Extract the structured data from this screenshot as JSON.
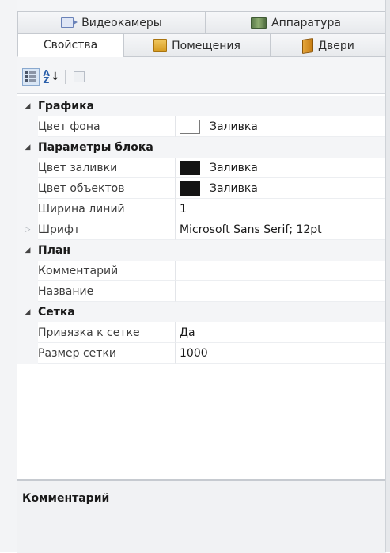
{
  "tabs_row1": [
    {
      "label": "Видеокамеры",
      "icon": "camera-icon"
    },
    {
      "label": "Аппаратура",
      "icon": "hardware-icon"
    }
  ],
  "tabs_row2": [
    {
      "label": "Свойства",
      "icon": null,
      "active": true
    },
    {
      "label": "Помещения",
      "icon": "rooms-icon"
    },
    {
      "label": "Двери",
      "icon": "door-icon"
    }
  ],
  "toolbar": {
    "categorized": "categorized-view-icon",
    "alphabetical": "sort-alphabetical-icon",
    "property_pages": "property-pages-icon"
  },
  "categories": {
    "graphics": "Графика",
    "block_params": "Параметры блока",
    "plan": "План",
    "grid": "Сетка"
  },
  "properties": {
    "bg_color": {
      "name": "Цвет фона",
      "value": "Заливка",
      "color": "#ffffff"
    },
    "fill_color": {
      "name": "Цвет заливки",
      "value": "Заливка",
      "color": "#141414"
    },
    "objects_color": {
      "name": "Цвет объектов",
      "value": "Заливка",
      "color": "#141414"
    },
    "line_width": {
      "name": "Ширина линий",
      "value": "1"
    },
    "font": {
      "name": "Шрифт",
      "value": "Microsoft Sans Serif; 12pt"
    },
    "comment": {
      "name": "Комментарий",
      "value": ""
    },
    "title": {
      "name": "Название",
      "value": ""
    },
    "snap": {
      "name": "Привязка к сетке",
      "value": "Да"
    },
    "grid_size": {
      "name": "Размер сетки",
      "value": "1000"
    }
  },
  "description": {
    "title": "Комментарий"
  }
}
